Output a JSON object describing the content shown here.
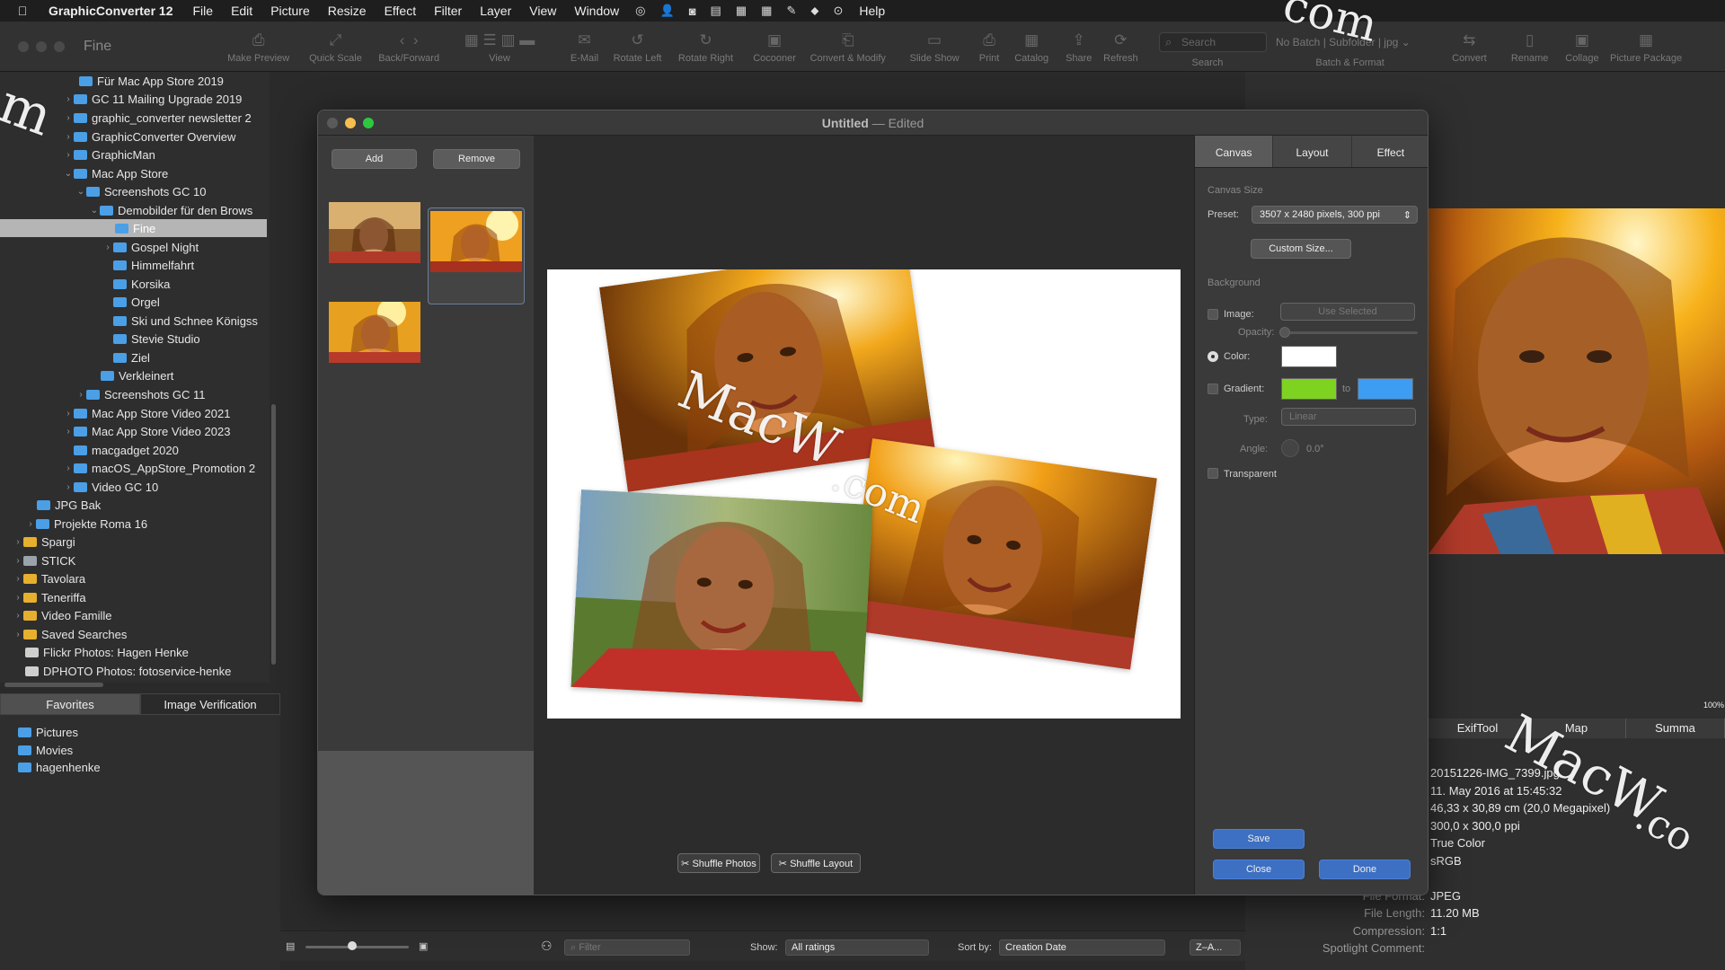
{
  "menubar": {
    "app_name": "GraphicConverter 12",
    "items": [
      "File",
      "Edit",
      "Picture",
      "Resize",
      "Effect",
      "Filter",
      "Layer",
      "View",
      "Window"
    ],
    "help": "Help"
  },
  "window": {
    "title": "Fine"
  },
  "toolbar": {
    "items": [
      "Make Preview",
      "Quick Scale",
      "Back/Forward",
      "View",
      "E-Mail",
      "Rotate Left",
      "Rotate Right",
      "Cocooner",
      "Convert & Modify",
      "Slide Show",
      "Print",
      "Catalog",
      "Share",
      "Refresh"
    ],
    "search_placeholder": "Search",
    "search_label": "Search",
    "batch_value": "No Batch | Subfolder | jpg",
    "batch_label": "Batch & Format",
    "right_items": [
      "Convert",
      "Rename",
      "Collage",
      "Picture Package"
    ]
  },
  "sidebar": {
    "items": [
      {
        "label": "Für Mac App Store 2019"
      },
      {
        "label": "GC 11 Mailing Upgrade 2019"
      },
      {
        "label": "graphic_converter newsletter 2"
      },
      {
        "label": "GraphicConverter Overview"
      },
      {
        "label": "GraphicMan"
      },
      {
        "label": "Mac App Store"
      },
      {
        "label": "Screenshots GC 10"
      },
      {
        "label": "Demobilder für den Brows"
      },
      {
        "label": "Fine"
      },
      {
        "label": "Gospel Night"
      },
      {
        "label": "Himmelfahrt"
      },
      {
        "label": "Korsika"
      },
      {
        "label": "Orgel"
      },
      {
        "label": "Ski und Schnee Königss"
      },
      {
        "label": "Stevie Studio"
      },
      {
        "label": "Ziel"
      },
      {
        "label": "Verkleinert"
      },
      {
        "label": "Screenshots GC 11"
      },
      {
        "label": "Mac App Store Video 2021"
      },
      {
        "label": "Mac App Store Video 2023"
      },
      {
        "label": "macgadget 2020"
      },
      {
        "label": "macOS_AppStore_Promotion 2"
      },
      {
        "label": "Video GC 10"
      },
      {
        "label": "JPG Bak"
      },
      {
        "label": "Projekte Roma 16"
      },
      {
        "label": "Spargi"
      },
      {
        "label": "STICK"
      },
      {
        "label": "Tavolara"
      },
      {
        "label": "Teneriffa"
      },
      {
        "label": "Video Famille"
      },
      {
        "label": "Saved Searches"
      },
      {
        "label": "Flickr Photos: Hagen Henke"
      },
      {
        "label": "DPHOTO Photos: fotoservice-henke"
      }
    ],
    "tabs": [
      "Favorites",
      "Image Verification"
    ],
    "favorites": [
      "Pictures",
      "Movies",
      "hagenhenke"
    ]
  },
  "dialog": {
    "title": "Untitled",
    "title_suffix": "Edited",
    "add_label": "Add",
    "remove_label": "Remove",
    "shuffle_photos": "Shuffle Photos",
    "shuffle_layout": "Shuffle Layout",
    "tabs": [
      "Canvas",
      "Layout",
      "Effect"
    ],
    "canvas_size_label": "Canvas Size",
    "preset_label": "Preset:",
    "preset_value": "3507 x 2480 pixels, 300 ppi",
    "custom_size": "Custom Size...",
    "background_label": "Background",
    "image_label": "Image:",
    "use_selected": "Use Selected",
    "opacity_label": "Opacity:",
    "color_label": "Color:",
    "gradient_label": "Gradient:",
    "to_label": "to",
    "type_label": "Type:",
    "type_value": "Linear",
    "angle_label": "Angle:",
    "angle_value": "0.0°",
    "transparent_label": "Transparent",
    "save": "Save",
    "close": "Close",
    "done": "Done",
    "colors": {
      "color_swatch": "#ffffff",
      "gradient_from": "#7ed321",
      "gradient_to": "#3d9df2"
    }
  },
  "info_panel": {
    "tabs": [
      "ExifTool",
      "Map",
      "Summa"
    ],
    "values": [
      "20151226-IMG_7399.jpg",
      "11. May 2016 at 15:45:32",
      "46,33 x 30,89 cm (20,0 Megapixel)",
      "300,0 x 300,0 ppi",
      "True Color",
      "sRGB"
    ],
    "labels": [
      "File Format:",
      "File Length:",
      "Compression:",
      "Spotlight Comment:"
    ],
    "label_values": [
      "JPEG",
      "11.20 MB",
      "1:1",
      ""
    ],
    "zoom": "100%"
  },
  "bottombar": {
    "filter_placeholder": "Filter",
    "show_label": "Show:",
    "show_value": "All ratings",
    "sort_label": "Sort by:",
    "sort_value": "Creation Date",
    "order_value": "Z–A..."
  },
  "watermark": {
    "text_a": "MacW",
    "text_b": ".com",
    "top_right": "com",
    "left": "m",
    "right_a": "MacW",
    "right_b": ".co"
  }
}
